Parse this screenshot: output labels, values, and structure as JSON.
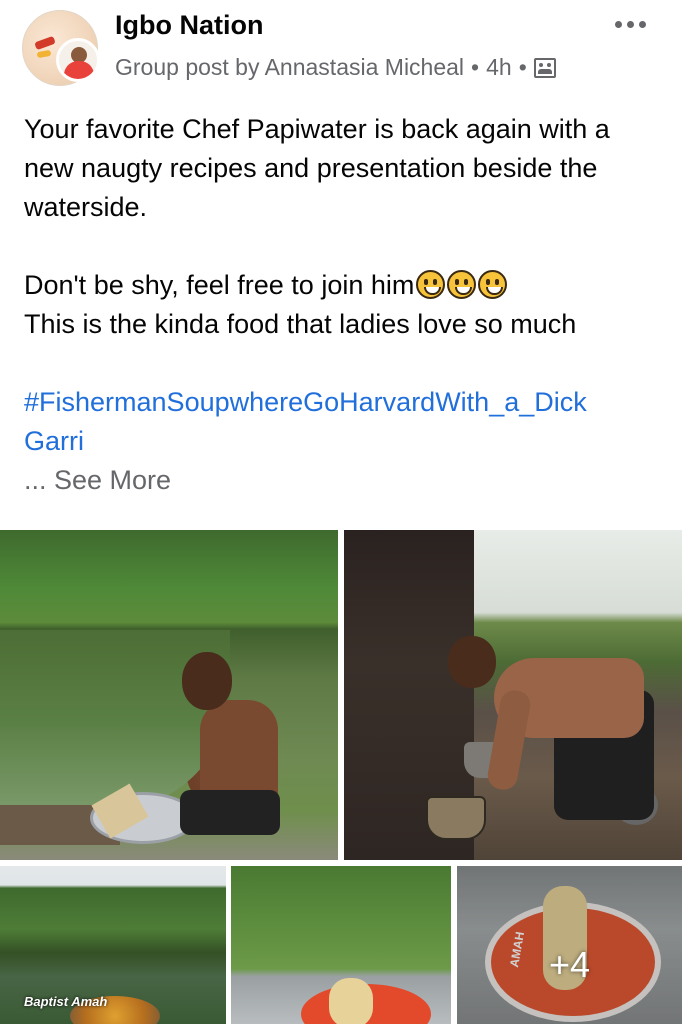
{
  "post": {
    "group_name": "Igbo Nation",
    "author_line": "Group post by Annastasia Micheal",
    "time": "4h",
    "separator": "•",
    "privacy_icon": "group-members-icon",
    "more_icon": "more-options-icon"
  },
  "body": {
    "line1": "Your favorite Chef Papiwater is back again with a new naugty recipes and presentation beside the waterside.",
    "line2": "Don't be shy, feel free to join him",
    "emoji": "grinning-face-emoji",
    "line3": "This is the kinda food that ladies love so much",
    "hashtag": "#FishermanSoupwhereGoHarvardWith_a_Dick",
    "hashtag_tail": "Garri",
    "see_more": "... See More"
  },
  "photos": {
    "watermark": "Baptist Amah",
    "watermark_2": "AMAH",
    "more_count": "+4"
  },
  "colors": {
    "link": "#216fdb",
    "meta_text": "#65676b",
    "main_text": "#050505"
  }
}
